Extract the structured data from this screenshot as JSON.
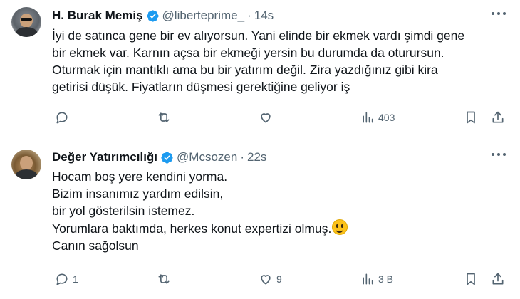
{
  "tweets": [
    {
      "name": "H. Burak Memiş",
      "handle": "@liberteprime_",
      "sep": "·",
      "time": "14s",
      "lines": [
        "İyi de satınca gene bir ev alıyorsun. Yani elinde bir ekmek vardı şimdi gene",
        "bir ekmek var. Karnın açsa bir ekmeği yersin bu durumda da oturursun.",
        "Oturmak için mantıklı ama bu bir yatırım değil. Zira yazdığınız gibi kira",
        "getirisi düşük. Fiyatların düşmesi gerektiğine geliyor iş"
      ],
      "actions": {
        "reply": "",
        "retweet": "",
        "like": "",
        "views": "403"
      },
      "icons": [
        "reply-icon",
        "retweet-icon",
        "like-icon",
        "views-icon",
        "bookmark-icon",
        "share-icon"
      ]
    },
    {
      "name": "Değer Yatırımcılığı",
      "handle": "@Mcsozen",
      "sep": "·",
      "time": "22s",
      "lines": [
        "Hocam boş yere kendini yorma.",
        "Bizim insanımız yardım edilsin,",
        "bir yol gösterilsin istemez.",
        "Yorumlara baktımda, herkes konut expertizi olmuş.",
        "Canın sağolsun"
      ],
      "actions": {
        "reply": "1",
        "retweet": "",
        "like": "9",
        "views": "3 B"
      },
      "icons": [
        "reply-icon",
        "retweet-icon",
        "like-icon",
        "views-icon",
        "bookmark-icon",
        "share-icon"
      ]
    }
  ],
  "colors": {
    "text": "#0f1419",
    "muted": "#536471",
    "verified": "#1d9bf0",
    "divider": "#eff3f4"
  }
}
